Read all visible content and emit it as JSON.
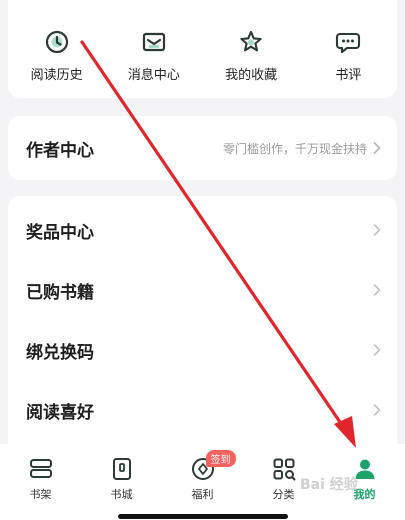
{
  "quick_actions": [
    {
      "label": "阅读历史",
      "icon": "clock-icon"
    },
    {
      "label": "消息中心",
      "icon": "message-icon"
    },
    {
      "label": "我的收藏",
      "icon": "star-icon"
    },
    {
      "label": "书评",
      "icon": "comment-icon"
    }
  ],
  "author_center": {
    "title": "作者中心",
    "subtitle": "零门槛创作，千万现金扶持"
  },
  "menu_items": [
    {
      "label": "奖品中心"
    },
    {
      "label": "已购书籍"
    },
    {
      "label": "绑兑换码"
    },
    {
      "label": "阅读喜好"
    }
  ],
  "tabbar": {
    "tabs": [
      {
        "label": "书架",
        "icon": "bookshelf-icon"
      },
      {
        "label": "书城",
        "icon": "bookstore-icon"
      },
      {
        "label": "福利",
        "icon": "welfare-icon",
        "badge": "签到"
      },
      {
        "label": "分类",
        "icon": "category-icon"
      },
      {
        "label": "我的",
        "icon": "profile-icon",
        "active": true
      }
    ]
  },
  "watermark": "Bai 经验",
  "colors": {
    "accent": "#1aa36b",
    "badge": "#f4625f",
    "arrow": "#e0262b",
    "icon_stroke": "#2b3a36"
  }
}
